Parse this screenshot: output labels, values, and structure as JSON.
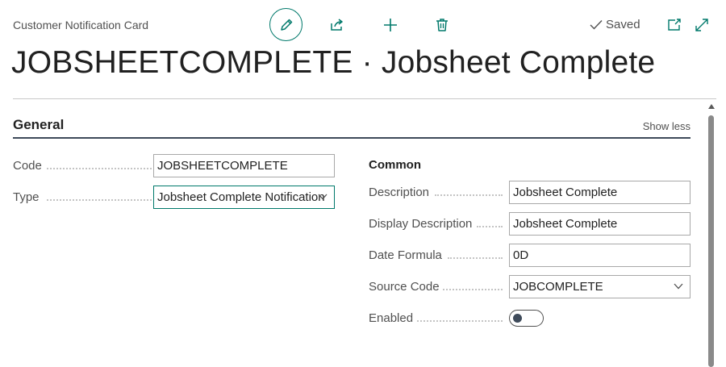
{
  "header": {
    "caption": "Customer Notification Card",
    "saved_label": "Saved",
    "title": "JOBSHEETCOMPLETE · Jobsheet Complete"
  },
  "actions": {
    "edit_icon": "pencil-icon",
    "share_icon": "share-icon",
    "new_icon": "plus-icon",
    "delete_icon": "trash-icon",
    "popout_icon": "open-in-new-window-icon",
    "expand_icon": "expand-icon"
  },
  "section": {
    "title": "General",
    "toggle_label": "Show less"
  },
  "left_fields": {
    "code": {
      "label": "Code",
      "value": "JOBSHEETCOMPLETE"
    },
    "type": {
      "label": "Type",
      "value": "Jobsheet Complete Notification"
    }
  },
  "common": {
    "title": "Common",
    "description": {
      "label": "Description",
      "value": "Jobsheet Complete"
    },
    "display_description": {
      "label": "Display Description",
      "value": "Jobsheet Complete"
    },
    "date_formula": {
      "label": "Date Formula",
      "value": "0D"
    },
    "source_code": {
      "label": "Source Code",
      "value": "JOBCOMPLETE"
    },
    "enabled": {
      "label": "Enabled",
      "value": false
    }
  },
  "colors": {
    "accent": "#00796b",
    "section_rule": "#3e4a5a",
    "text": "#212121",
    "muted": "#505050"
  }
}
